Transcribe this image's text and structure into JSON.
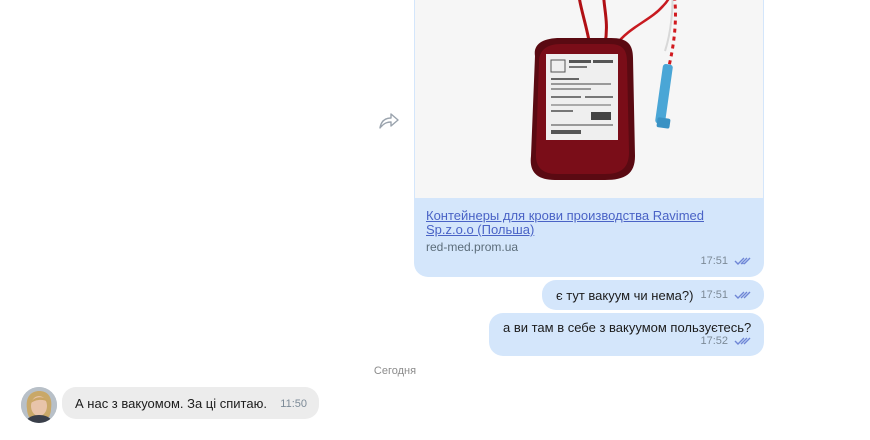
{
  "messages": {
    "link_preview": {
      "link_text": "Контейнеры для крови производства Ravimed Sp.z.o.o  (Польша)",
      "domain": "red-med.prom.ua",
      "time": "17:51"
    },
    "outgoing": [
      {
        "text": "є тут вакуум чи нема?)",
        "time": "17:51"
      },
      {
        "text": "а ви там в себе з вакуумом пользуєтесь?",
        "time": "17:52"
      }
    ],
    "day_separator": "Сегодня",
    "incoming": [
      {
        "text": "А нас з вакуомом. За ці спитаю.",
        "time": "11:50"
      }
    ]
  },
  "colors": {
    "outgoing_bubble": "#d4e6fb",
    "incoming_bubble": "#ececec",
    "link": "#4a63c6",
    "read_ticks": "#6f86d6"
  },
  "icons": {
    "share": "share-arrow-icon",
    "read_status": "double-check-icon"
  }
}
